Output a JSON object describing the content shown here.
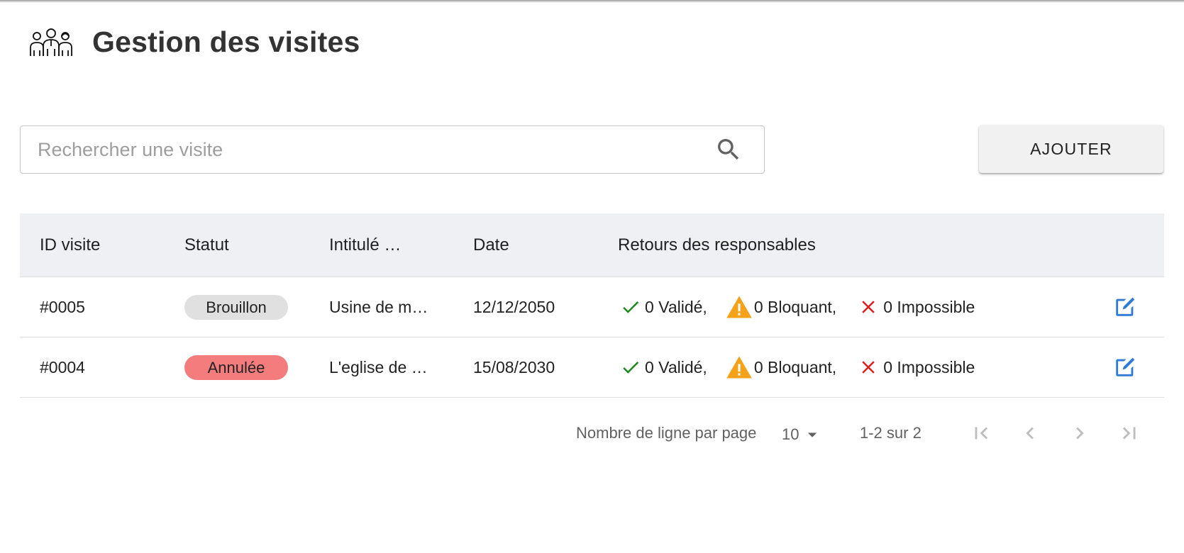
{
  "header": {
    "title": "Gestion des visites",
    "logo_icon": "people-group-icon"
  },
  "search": {
    "placeholder": "Rechercher une visite",
    "value": "",
    "icon": "search-icon"
  },
  "toolbar": {
    "add_label": "AJOUTER"
  },
  "table": {
    "columns": [
      "ID visite",
      "Statut",
      "Intitulé …",
      "Date",
      "Retours des responsables"
    ],
    "rows": [
      {
        "id": "#0005",
        "status": "Brouillon",
        "status_color": "#e0e0e0",
        "title": "Usine de m…",
        "date": "12/12/2050",
        "valid": "0 Validé,",
        "blocking": "0 Bloquant,",
        "impossible": "0 Impossible"
      },
      {
        "id": "#0004",
        "status": "Annulée",
        "status_color": "#f47c7c",
        "title": "L'eglise de …",
        "date": "15/08/2030",
        "valid": "0 Validé,",
        "blocking": "0 Bloquant,",
        "impossible": "0 Impossible"
      }
    ]
  },
  "pagination": {
    "rows_per_page_label": "Nombre de ligne par page",
    "rows_per_page": "10",
    "range": "1-2 sur 2"
  },
  "colors": {
    "valid": "#1a8a1a",
    "warning": "#f5a21b",
    "impossible": "#e01e1e",
    "edit": "#2f7bd6"
  }
}
